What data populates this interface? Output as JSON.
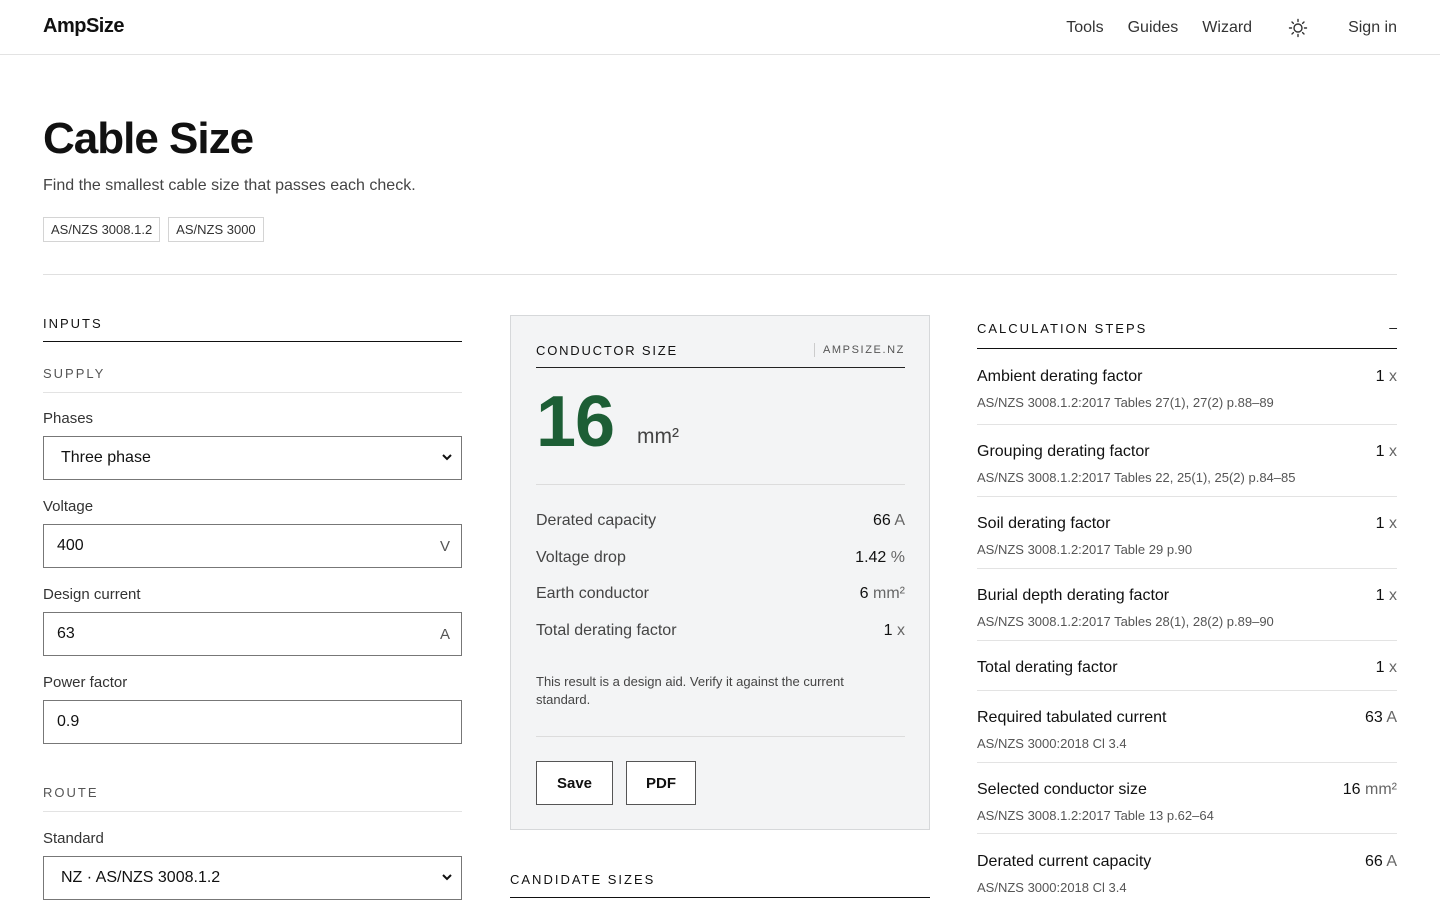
{
  "header": {
    "logo": "AmpSize",
    "nav": [
      "Tools",
      "Guides",
      "Wizard"
    ],
    "theme_icon": "sun-icon",
    "signin": "Sign in"
  },
  "page": {
    "title": "Cable Size",
    "subtitle": "Find the smallest cable size that passes each check.",
    "tags": [
      "AS/NZS 3008.1.2",
      "AS/NZS 3000"
    ]
  },
  "inputs": {
    "heading": "INPUTS",
    "supply_heading": "SUPPLY",
    "phases_label": "Phases",
    "phases_value": "Three phase",
    "voltage_label": "Voltage",
    "voltage_value": "400",
    "voltage_unit": "V",
    "current_label": "Design current",
    "current_value": "63",
    "current_unit": "A",
    "pf_label": "Power factor",
    "pf_value": "0.9",
    "route_heading": "ROUTE",
    "standard_label": "Standard",
    "standard_value": "NZ · AS/NZS 3008.1.2"
  },
  "result": {
    "label": "CONDUCTOR SIZE",
    "brand": "AMPSIZE.NZ",
    "size": "16",
    "size_unit": "mm²",
    "rows": [
      {
        "label": "Derated capacity",
        "value": "66",
        "unit": "A"
      },
      {
        "label": "Voltage drop",
        "value": "1.42",
        "unit": "%"
      },
      {
        "label": "Earth conductor",
        "value": "6",
        "unit": "mm²"
      },
      {
        "label": "Total derating factor",
        "value": "1",
        "unit": "x"
      }
    ],
    "note": "This result is a design aid. Verify it against the current standard.",
    "save": "Save",
    "pdf": "PDF"
  },
  "candidates": {
    "heading": "CANDIDATE SIZES"
  },
  "steps": {
    "heading": "CALCULATION STEPS",
    "toggle": "–",
    "items": [
      {
        "name": "Ambient derating factor",
        "value": "1",
        "unit": "x",
        "ref": "AS/NZS 3008.1.2:2017 Tables 27(1), 27(2) p.88–89"
      },
      {
        "name": "Grouping derating factor",
        "value": "1",
        "unit": "x",
        "ref": "AS/NZS 3008.1.2:2017 Tables 22, 25(1), 25(2) p.84–85"
      },
      {
        "name": "Soil derating factor",
        "value": "1",
        "unit": "x",
        "ref": "AS/NZS 3008.1.2:2017 Table 29 p.90"
      },
      {
        "name": "Burial depth derating factor",
        "value": "1",
        "unit": "x",
        "ref": "AS/NZS 3008.1.2:2017 Tables 28(1), 28(2) p.89–90"
      },
      {
        "name": "Total derating factor",
        "value": "1",
        "unit": "x",
        "ref": ""
      },
      {
        "name": "Required tabulated current",
        "value": "63",
        "unit": "A",
        "ref": "AS/NZS 3000:2018 Cl 3.4"
      },
      {
        "name": "Selected conductor size",
        "value": "16",
        "unit": "mm²",
        "ref": "AS/NZS 3008.1.2:2017 Table 13 p.62–64"
      },
      {
        "name": "Derated current capacity",
        "value": "66",
        "unit": "A",
        "ref": "AS/NZS 3000:2018 Cl 3.4"
      }
    ]
  },
  "colors": {
    "accent_green": "#1d5e35",
    "card_bg": "#f3f4f5"
  }
}
